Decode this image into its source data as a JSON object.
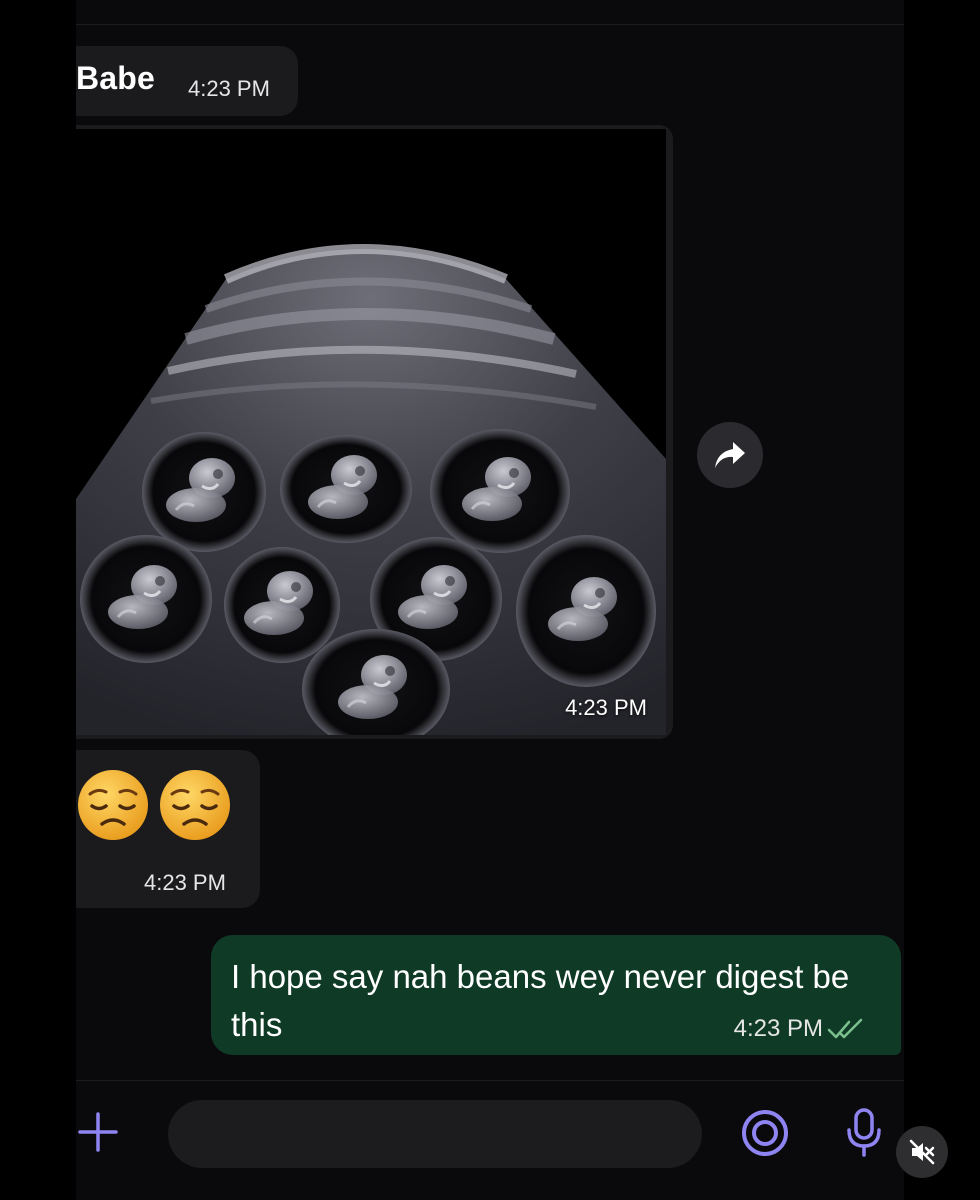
{
  "chat": {
    "sender_name": "Babe",
    "sender_time": "4:23 PM",
    "image_message": {
      "time": "4:23 PM",
      "icon": "ultrasound-image"
    },
    "emoji_message": {
      "emojis": [
        "😔",
        "😔"
      ],
      "time": "4:23 PM"
    },
    "outgoing_message": {
      "text": "I hope say nah beans wey never digest be this",
      "time": "4:23 PM",
      "status_icon": "double-check-icon"
    }
  },
  "composer": {
    "placeholder": "",
    "icons": [
      "plus-icon",
      "camera-icon",
      "microphone-icon"
    ]
  },
  "overlay": {
    "icon": "muted-speaker-icon"
  },
  "colors": {
    "background": "#0a0a0c",
    "incoming_bubble": "#1b1b1e",
    "outgoing_bubble": "#0f3b26",
    "accent": "#8f85f2",
    "read_check": "#7cc08f"
  }
}
